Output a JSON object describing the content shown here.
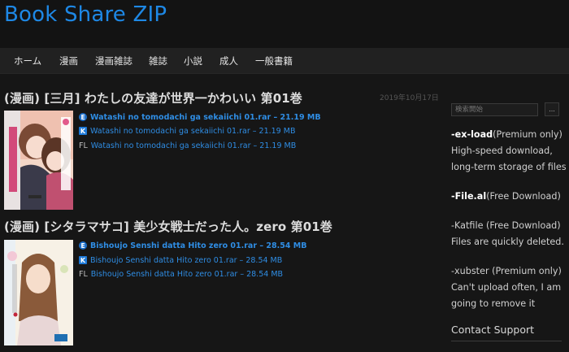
{
  "site": {
    "title": "Book Share ZIP"
  },
  "nav": [
    {
      "label": "ホーム"
    },
    {
      "label": "漫画"
    },
    {
      "label": "漫画雑誌"
    },
    {
      "label": "雑誌"
    },
    {
      "label": "小説"
    },
    {
      "label": "成人"
    },
    {
      "label": "一般書籍"
    }
  ],
  "posts": [
    {
      "title": "(漫画) [三月] わたしの友達が世界一かわいい 第01巻",
      "date": "2019年10月17日",
      "cover_alt": "わたしの友達が世界一かわいい",
      "links": [
        {
          "host": "E",
          "text": "Watashi no tomodachi ga sekaiichi 01.rar – 21.19 MB"
        },
        {
          "host": "K",
          "text": "Watashi no tomodachi ga sekaiichi 01.rar – 21.19 MB"
        },
        {
          "host": "FL",
          "text": "Watashi no tomodachi ga sekaiichi 01.rar – 21.19 MB"
        }
      ]
    },
    {
      "title": "(漫画) [シタラマサコ] 美少女戦士だった人。zero 第01巻",
      "cover_alt": "美少女戦士だった人。",
      "links": [
        {
          "host": "E",
          "text": "Bishoujo Senshi datta Hito zero 01.rar – 28.54 MB"
        },
        {
          "host": "K",
          "text": "Bishoujo Senshi datta Hito zero 01.rar – 28.54 MB"
        },
        {
          "host": "FL",
          "text": "Bishoujo Senshi datta Hito zero 01.rar – 28.54 MB"
        }
      ]
    }
  ],
  "sidebar": {
    "search_placeholder": "検索開始",
    "search_button": "...",
    "hosts": [
      {
        "name": "-ex-load",
        "desc": "(Premium only) High-speed download, long-term storage of files"
      },
      {
        "name": "-File.al",
        "desc": "(Free Download)"
      },
      {
        "name": "",
        "desc": "-Katfile (Free Download) Files are quickly deleted."
      },
      {
        "name": "",
        "desc": "-xubster (Premium only) Can't upload often, I am going to remove it"
      }
    ],
    "contact": "Contact Support"
  },
  "colors": {
    "accent": "#1e88e5",
    "link": "#2f8de4",
    "background": "#161616"
  }
}
